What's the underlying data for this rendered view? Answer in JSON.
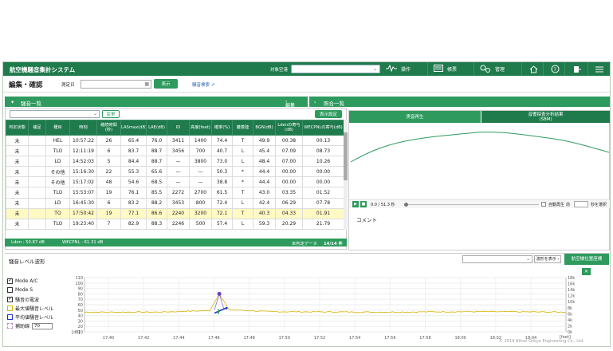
{
  "header": {
    "app_title": "航空機騒音集計システム",
    "airport_label": "対象空港",
    "airport_value": "",
    "menu": [
      {
        "label": "操作",
        "icon": "waveform-icon"
      },
      {
        "label": "帳票",
        "icon": "document-icon"
      },
      {
        "label": "管理",
        "icon": "gears-icon"
      }
    ],
    "icons": [
      "home-icon",
      "help-icon",
      "logout-icon",
      "hamburger-menu-icon"
    ]
  },
  "subheader": {
    "page_title": "編集・確認",
    "date_label": "測定日",
    "date_value": "",
    "show_button": "表示",
    "search_link": "騒音検索"
  },
  "left_panel": {
    "title": "騒音一覧",
    "edit_label": "編集",
    "filter_value": "",
    "change_button": "変更",
    "show_settings_button": "表示設定",
    "columns": [
      "判定状態",
      "補足",
      "種目",
      "時刻",
      "継続時間(秒)",
      "LASmax(dB)",
      "LAE(dB)",
      "ID",
      "高度(feet)",
      "確率(%)",
      "離着陸",
      "BGN(dB)",
      "Ldenの寄与(dB)",
      "WECPNLの寄与(dB)"
    ],
    "rows": [
      [
        "未",
        "",
        "HEL",
        "10:57:22",
        "26",
        "65.4",
        "76.0",
        "3411",
        "1400",
        "74.4",
        "T",
        "49.9",
        "00.38",
        "00.13"
      ],
      [
        "未",
        "",
        "TLO",
        "12:11:19",
        "6",
        "83.7",
        "88.7",
        "3456",
        "700",
        "40.7",
        "L",
        "45.4",
        "07.09",
        "08.73"
      ],
      [
        "未",
        "",
        "LD",
        "14:52:03",
        "5",
        "84.4",
        "88.7",
        "—",
        "3800",
        "73.0",
        "L",
        "48.4",
        "07.00",
        "10.26"
      ],
      [
        "未",
        "",
        "その他",
        "15:16:30",
        "22",
        "55.3",
        "65.6",
        "—",
        "—",
        "50.3",
        "*",
        "44.4",
        "00.00",
        "00.00"
      ],
      [
        "未",
        "",
        "その他",
        "15:17:02",
        "48",
        "54.6",
        "68.5",
        "—",
        "—",
        "38.8",
        "*",
        "44.4",
        "00.00",
        "00.00"
      ],
      [
        "未",
        "",
        "TLO",
        "15:53:07",
        "19",
        "76.1",
        "85.5",
        "2272",
        "2700",
        "61.5",
        "T",
        "43.0",
        "03.35",
        "01.52"
      ],
      [
        "未",
        "",
        "LD",
        "16:45:30",
        "6",
        "83.2",
        "88.2",
        "3453",
        "800",
        "72.4",
        "L",
        "42.4",
        "06.29",
        "07.78"
      ],
      [
        "未",
        "",
        "TO",
        "17:50:42",
        "19",
        "77.1",
        "86.6",
        "2240",
        "3200",
        "72.1",
        "T",
        "40.3",
        "04.33",
        "01.91"
      ],
      [
        "未",
        "",
        "TLO",
        "19:23:40",
        "7",
        "82.9",
        "88.3",
        "2246",
        "500",
        "57.4",
        "L",
        "59.3",
        "20.29",
        "21.79"
      ]
    ],
    "footer": {
      "lden": "Lden : 50.87 dB",
      "wecpnl": "WECPNL : 61.31 dB",
      "unknown": "未判定データ",
      "count": "14/14 件"
    }
  },
  "right_panel": {
    "title": "照合一覧",
    "tab_playback": "実音再生",
    "tab_analysis_line1": "音響探査分析結果",
    "tab_analysis_line2": "(SBM)",
    "time_text": "0.0 / 51.3 秒",
    "auto_play_label": "自動再生",
    "before_label": "前",
    "seconds_label": "秒を選択",
    "comment_label": "コメント"
  },
  "waveform": {
    "title": "騒音レベル波形",
    "select_value": "",
    "display_button": "波形を表示",
    "position_tab": "航空機位置座標",
    "legend": [
      {
        "label": "Mode A/C",
        "color": "#333333"
      },
      {
        "label": "Mode S",
        "color": "#333333"
      },
      {
        "label": "騒音の電波",
        "color": "#333333"
      },
      {
        "label": "最大値騒音レベル",
        "color": "#d8b400"
      },
      {
        "label": "平均値騒音レベル",
        "color": "#2233cc"
      },
      {
        "label": "補助線",
        "color": "#c080c0"
      }
    ],
    "aux_value": "70",
    "yticks": [
      "110",
      "100",
      "90",
      "80",
      "70",
      "60",
      "50",
      "40",
      "30",
      "20",
      "10"
    ],
    "yticks_right": [
      "18k",
      "16k",
      "14k",
      "12k",
      "10k",
      "8k",
      "6k",
      "4k",
      "2k",
      "0k"
    ],
    "xticks": [
      "17:40",
      "17:42",
      "17:44",
      "17:46",
      "17:48",
      "17:50",
      "17:52",
      "17:54",
      "17:56",
      "17:58",
      "18:00",
      "18:02",
      "18:04"
    ],
    "ylabel": "[dB]",
    "ylabel_right": "[feet]",
    "copyright": "© 2019 Nihon Onkyo Engineering Co., Ltd."
  },
  "chart_data": {
    "type": "line",
    "xlim": [
      "17:39",
      "18:06"
    ],
    "ylim": [
      0,
      110
    ],
    "series": [
      {
        "values": [
          [
            0,
            40
          ],
          [
            15,
            40
          ],
          [
            26,
            43
          ],
          [
            28,
            77
          ],
          [
            30,
            45
          ],
          [
            38,
            41
          ],
          [
            60,
            40
          ],
          [
            80,
            41
          ],
          [
            100,
            40
          ]
        ]
      }
    ]
  }
}
